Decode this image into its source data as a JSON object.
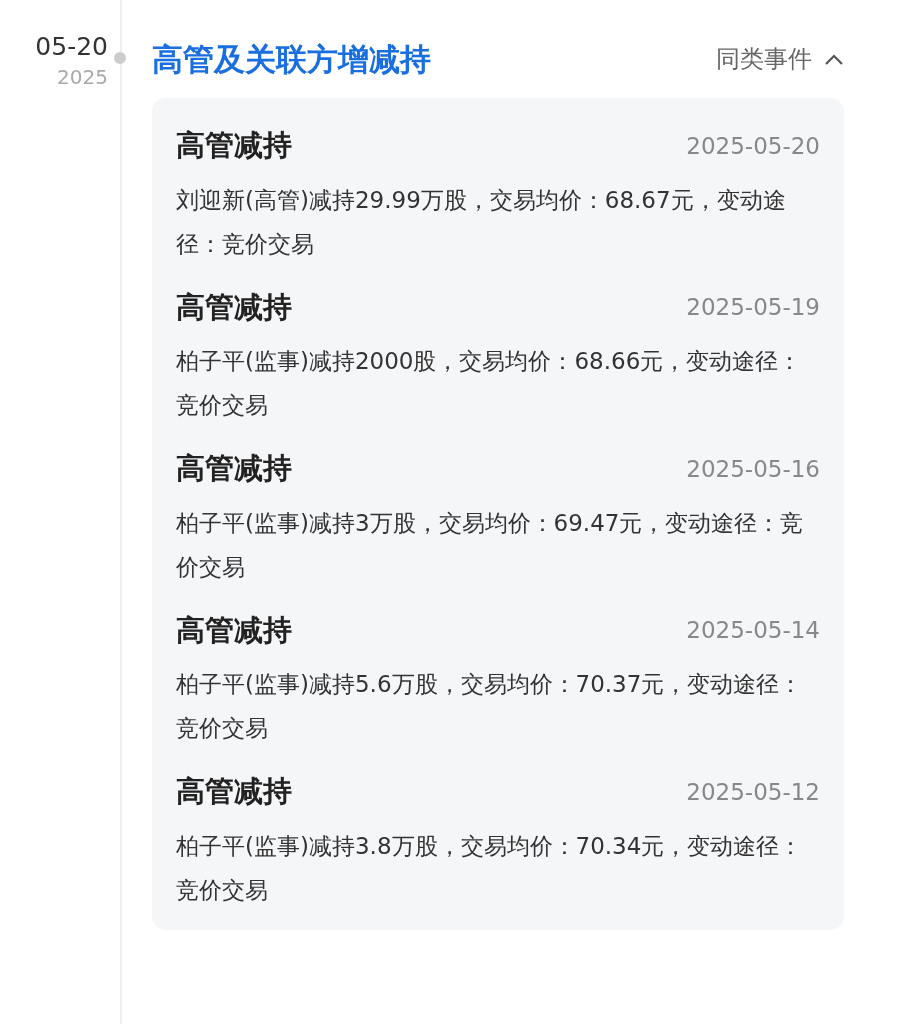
{
  "event": {
    "date": "05-20",
    "year": "2025",
    "title": "高管及关联方增减持",
    "similar": {
      "label": "同类事件",
      "expanded": true
    },
    "items": [
      {
        "title": "高管减持",
        "date": "2025-05-20",
        "text": "刘迎新(高管)减持29.99万股，交易均价：68.67元，变动途径：竞价交易"
      },
      {
        "title": "高管减持",
        "date": "2025-05-19",
        "text": "柏子平(监事)减持2000股，交易均价：68.66元，变动途径：竞价交易"
      },
      {
        "title": "高管减持",
        "date": "2025-05-16",
        "text": "柏子平(监事)减持3万股，交易均价：69.47元，变动途径：竞价交易"
      },
      {
        "title": "高管减持",
        "date": "2025-05-14",
        "text": "柏子平(监事)减持5.6万股，交易均价：70.37元，变动途径：竞价交易"
      },
      {
        "title": "高管减持",
        "date": "2025-05-12",
        "text": "柏子平(监事)减持3.8万股，交易均价：70.34元，变动途径：竞价交易"
      }
    ]
  }
}
